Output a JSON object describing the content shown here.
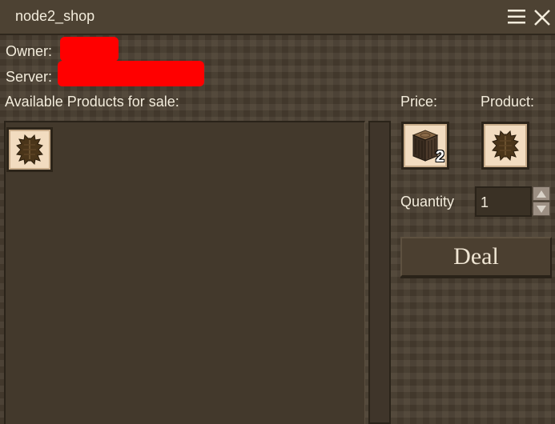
{
  "window": {
    "title": "node2_shop"
  },
  "info": {
    "owner_label": "Owner:",
    "server_label": "Server:"
  },
  "products": {
    "heading": "Available Products for sale:",
    "items": [
      {
        "icon": "leather-hide-icon"
      }
    ]
  },
  "trade": {
    "price_label": "Price:",
    "product_label": "Product:",
    "price_item": {
      "icon": "wood-log-icon",
      "count": "2"
    },
    "product_item": {
      "icon": "leather-hide-icon"
    },
    "quantity_label": "Quantity",
    "quantity_value": "1",
    "deal_label": "Deal"
  },
  "colors": {
    "redaction": "#ff0000",
    "slot_bg": "#f2dcc0",
    "panel_bg": "#4a3f31"
  }
}
